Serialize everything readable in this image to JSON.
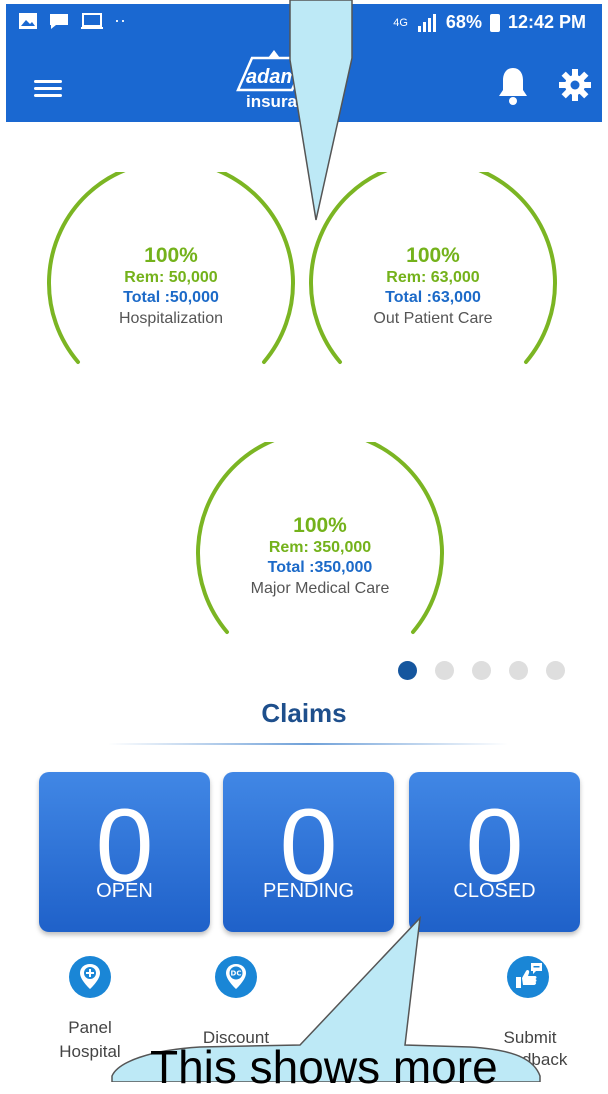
{
  "status_bar": {
    "network": "4G",
    "battery": "68%",
    "time": "12:42 PM"
  },
  "header": {
    "logo_top": "adamjee",
    "logo_bottom": "insurance",
    "icons": [
      "menu-icon",
      "bell-icon",
      "gear-icon"
    ],
    "color": "#1a68d1"
  },
  "gauges": [
    {
      "percent": "100%",
      "remaining": "Rem: 50,000",
      "total": "Total :50,000",
      "label": "Hospitalization"
    },
    {
      "percent": "100%",
      "remaining": "Rem: 63,000",
      "total": "Total :63,000",
      "label": "Out Patient Care"
    },
    {
      "percent": "100%",
      "remaining": "Rem: 350,000",
      "total": "Total :350,000",
      "label": "Major Medical Care"
    }
  ],
  "pager": {
    "count": 5,
    "active": 1
  },
  "claims": {
    "title": "Claims",
    "tiles": [
      {
        "count": "0",
        "label": "OPEN"
      },
      {
        "count": "0",
        "label": "PENDING"
      },
      {
        "count": "0",
        "label": "CLOSED"
      }
    ]
  },
  "shortcuts": [
    {
      "label_line1": "Panel",
      "label_line2": "Hospital"
    },
    {
      "label_line1": "Discount",
      "label_line2": ""
    },
    {
      "label_line1": "Submit",
      "label_line2": "Feedback"
    }
  ],
  "tooltip": {
    "text": "This shows more"
  },
  "colors": {
    "accent_green": "#74b21b",
    "accent_blue": "#1c6ac8",
    "tile_blue": "#2a6fd6",
    "tooltip_fill": "#bde9f6"
  }
}
